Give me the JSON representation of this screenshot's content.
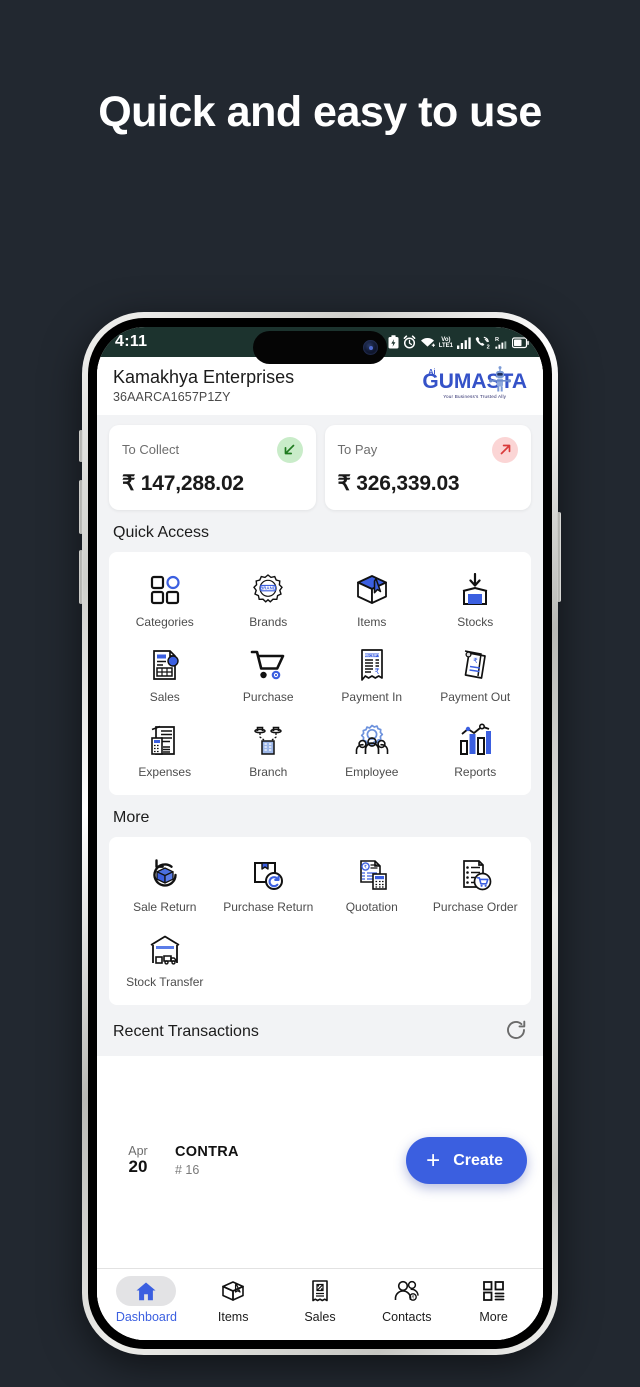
{
  "hero": {
    "headline": "Quick and easy to use"
  },
  "status_bar": {
    "time": "4:11",
    "icons": [
      "battery-saver-icon",
      "alarm-icon",
      "wifi-icon",
      "volte-icon",
      "signal-bars-icon",
      "call-volte2-icon",
      "roaming-signal-icon",
      "battery-icon"
    ],
    "volte_label": "Vo)",
    "lte_label": "LTE1",
    "roaming_label": "R",
    "sim2_label": "2"
  },
  "app_header": {
    "business_name": "Kamakhya Enterprises",
    "gstin": "36AARCA1657P1ZY",
    "logo_prefix": "Ai",
    "logo_text": "GUMASTA",
    "logo_tagline": "Your Business's Trusted Ally"
  },
  "summary": {
    "cards": [
      {
        "label": "To Collect",
        "amount": "₹ 147,288.02",
        "icon": "arrow-down-left-icon",
        "tone": "green",
        "color": "#1f7a1f"
      },
      {
        "label": "To Pay",
        "amount": "₹ 326,339.03",
        "icon": "arrow-up-right-icon",
        "tone": "red",
        "color": "#d32f2f"
      }
    ]
  },
  "quick_access": {
    "title": "Quick Access",
    "rows": [
      [
        {
          "label": "Categories",
          "icon": "categories-icon"
        },
        {
          "label": "Brands",
          "icon": "brand-badge-icon"
        },
        {
          "label": "Items",
          "icon": "box-icon"
        },
        {
          "label": "Stocks",
          "icon": "stock-in-icon"
        }
      ],
      [
        {
          "label": "Sales",
          "icon": "sales-invoice-icon"
        },
        {
          "label": "Purchase",
          "icon": "shopping-cart-icon"
        },
        {
          "label": "Payment In",
          "icon": "receipt-in-icon"
        },
        {
          "label": "Payment Out",
          "icon": "payment-out-icon"
        }
      ],
      [
        {
          "label": "Expenses",
          "icon": "expenses-icon"
        },
        {
          "label": "Branch",
          "icon": "branch-icon"
        },
        {
          "label": "Employee",
          "icon": "employee-gear-icon"
        },
        {
          "label": "Reports",
          "icon": "reports-chart-icon"
        }
      ]
    ]
  },
  "more": {
    "title": "More",
    "rows": [
      [
        {
          "label": "Sale Return",
          "icon": "sale-return-icon"
        },
        {
          "label": "Purchase Return",
          "icon": "purchase-return-icon"
        },
        {
          "label": "Quotation",
          "icon": "quotation-icon"
        },
        {
          "label": "Purchase Order",
          "icon": "purchase-order-icon"
        }
      ],
      [
        {
          "label": "Stock Transfer",
          "icon": "stock-transfer-icon"
        }
      ]
    ]
  },
  "recent": {
    "title": "Recent Transactions",
    "refresh_icon": "refresh-icon",
    "transactions": [
      {
        "month": "Apr",
        "day": "20",
        "type": "CONTRA",
        "number": "# 16"
      }
    ]
  },
  "fab": {
    "label": "Create",
    "icon": "plus-icon",
    "color": "#3b5fe0"
  },
  "bottom_nav": {
    "items": [
      {
        "label": "Dashboard",
        "icon": "home-icon",
        "active": true
      },
      {
        "label": "Items",
        "icon": "box-icon",
        "active": false
      },
      {
        "label": "Sales",
        "icon": "invoice-icon",
        "active": false
      },
      {
        "label": "Contacts",
        "icon": "contacts-icon",
        "active": false
      },
      {
        "label": "More",
        "icon": "grid-more-icon",
        "active": false
      }
    ]
  },
  "theme": {
    "background": "#222830",
    "accent": "#3b5fe0",
    "status_bar_bg": "#1c332e",
    "app_bg": "#f2f3f5"
  }
}
